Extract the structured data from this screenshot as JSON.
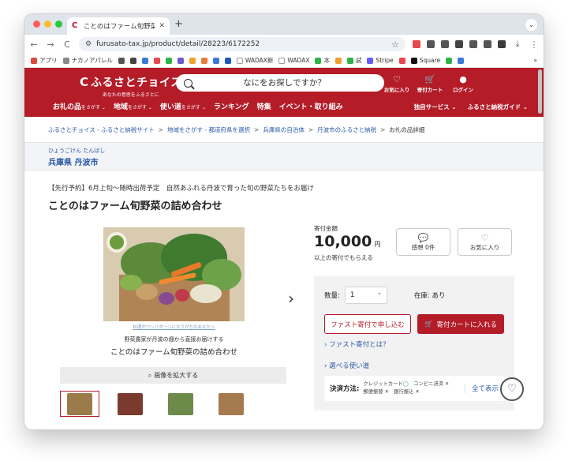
{
  "browser": {
    "tab_title": "ことのはファーム旬野菜の詰め",
    "tab_favicon": "C",
    "close_glyph": "✕",
    "new_tab_glyph": "+",
    "tab_menu_glyph": "⌄",
    "url": "furusato-tax.jp/product/detail/28223/6172252",
    "site_info_glyph": "⚙",
    "star_glyph": "☆",
    "back_glyph": "←",
    "forward_glyph": "→",
    "reload_glyph": "C",
    "menu_glyph": "⋮",
    "download_glyph": "⤓",
    "extensions_colors": [
      "#e8474c",
      "#555555",
      "#555555",
      "#444444",
      "#555555",
      "#555555",
      "#3b3b3b"
    ]
  },
  "bookmarks": {
    "apps_label": "アプリ",
    "items": [
      {
        "label": "ナカノアパレル",
        "color": "#888888"
      },
      {
        "label": "",
        "color": "#555555"
      },
      {
        "label": "",
        "color": "#444444"
      },
      {
        "label": "",
        "color": "#3a7bd5"
      },
      {
        "label": "",
        "color": "#e8474c"
      },
      {
        "label": "",
        "color": "#2db34a"
      },
      {
        "label": "",
        "color": "#6a5acd"
      },
      {
        "label": "",
        "color": "#f0a030"
      },
      {
        "label": "",
        "color": "#e87d3e"
      },
      {
        "label": "",
        "color": "#3a7bd5"
      },
      {
        "label": "",
        "color": "#1e5bb8"
      },
      {
        "label": "WADAX新",
        "color": "#ffffff"
      },
      {
        "label": "WADAX",
        "color": "#ffffff"
      },
      {
        "label": "本",
        "color": "#2db34a"
      },
      {
        "label": "",
        "color": "#f0a030"
      },
      {
        "label": "試",
        "color": "#2db34a"
      },
      {
        "label": "Stripe",
        "color": "#635bff"
      },
      {
        "label": "",
        "color": "#e8474c"
      },
      {
        "label": "Square",
        "color": "#111111"
      },
      {
        "label": "",
        "color": "#2db34a"
      },
      {
        "label": "",
        "color": "#3a7bd5"
      }
    ],
    "overflow": "»"
  },
  "header": {
    "logo_mark": "C",
    "logo_name": "ふるさとチョイス",
    "logo_tagline": "あなたの意思をふるさとに",
    "search_placeholder": "なにをお探しですか？",
    "icons": [
      {
        "name": "favorite",
        "glyph": "♡",
        "label": "お気に入り"
      },
      {
        "name": "cart",
        "glyph": "🛒",
        "label": "寄付カート"
      },
      {
        "name": "login",
        "glyph": "●",
        "label": "ログイン"
      }
    ],
    "nav": [
      {
        "label": "お礼の品",
        "sub": "をさがす ⌄"
      },
      {
        "label": "地域",
        "sub": "をさがす ⌄"
      },
      {
        "label": "使い道",
        "sub": "をさがす ⌄"
      },
      {
        "label": "ランキング",
        "sub": ""
      },
      {
        "label": "特集",
        "sub": ""
      },
      {
        "label": "イベント・取り組み",
        "sub": ""
      }
    ],
    "nav_right": [
      "独自サービス ⌄",
      "ふるさと納税ガイド ⌄"
    ]
  },
  "breadcrumb": {
    "items": [
      "ふるさとチョイス - ふるさと納税サイト",
      "地域をさがす - 都道府県を選択",
      "兵庫県の自治体",
      "丹波市のふるさと納税"
    ],
    "separator": ">",
    "current": "お礼の品詳細"
  },
  "region": {
    "kana": "ひょうごけん たんばし",
    "place": "兵庫県 丹波市"
  },
  "product": {
    "subtitle": "【先行予約】6月上旬～随時出荷予定　自然あふれる丹波で育った旬の野菜たちをお届け",
    "title": "ことのはファーム旬野菜の詰め合わせ",
    "image_caption_link": "料理がワンパターンになりがちなあなたへ",
    "image_caption_line1": "野菜農家が丹波の畑から直接お届けする",
    "image_caption_line2": "ことのはファーム旬野菜の詰め合わせ",
    "next_glyph": "›",
    "zoom_label": "画像を拡大する",
    "zoom_glyph": "⌕",
    "thumbnail_colors": [
      "#9c7b4a",
      "#7a3b2e",
      "#6d8a4a",
      "#a67a4f"
    ],
    "price_label": "寄付金額",
    "price": "10,000",
    "price_unit": "円",
    "price_note": "以上の寄付でもらえる",
    "comments_glyph": "💬",
    "comments_label": "感想 0件",
    "favorite_glyph": "♡",
    "favorite_label": "お気に入り",
    "qty_label": "数量:",
    "qty_value": "1",
    "qty_arrows": "⌃",
    "stock_label": "在庫: あり",
    "fast_button": "ファスト寄付で申し込む",
    "cart_button": "寄付カートに入れる",
    "cart_glyph": "🛒",
    "fast_link": "› ファスト寄付とは？",
    "usage_link": "› 選べる使い道",
    "payment_label": "決済方法:",
    "payment_line1_a": "クレジットカード",
    "payment_line1_ok": "◯",
    "payment_line1_b": "コンビニ決済 ✕",
    "payment_line2": "郵便振替 ✕　銀行振込 ✕",
    "payment_all": "全て表示",
    "float_fav_glyph": "♡"
  },
  "colors": {
    "brand": "#b41c28",
    "link": "#2a5aa8"
  }
}
